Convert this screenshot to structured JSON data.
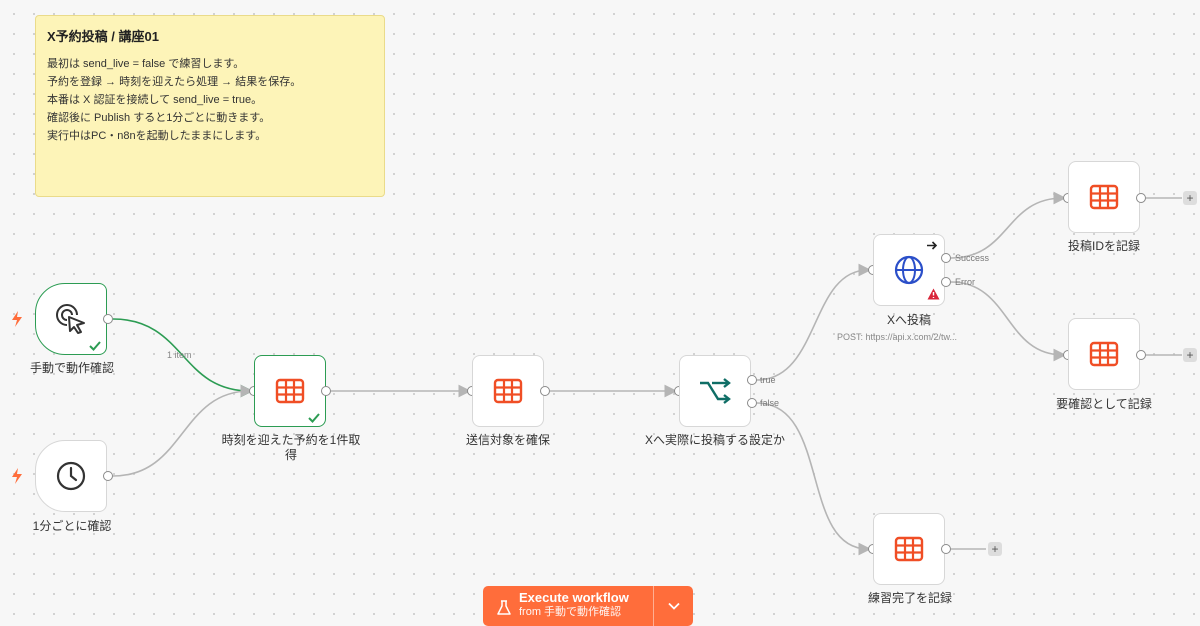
{
  "sticky": {
    "title": "X予約投稿 / 講座01",
    "lines": [
      "最初は send_live = false で練習します。",
      "予約を登録 → 時刻を迎えたら処理 → 結果を保存。",
      "本番は X 認証を接続して send_live = true。",
      "確認後に Publish すると1分ごとに動きます。",
      "実行中はPC・n8nを起動したままにします。"
    ]
  },
  "nodes": {
    "manual": {
      "label": "手動で動作確認"
    },
    "schedule": {
      "label": "1分ごとに確認"
    },
    "fetch": {
      "label_line1": "時刻を迎えた予約を1件取",
      "label_line2": "得"
    },
    "secure": {
      "label": "送信対象を確保"
    },
    "if": {
      "label": "Xへ実際に投稿する設定か",
      "true_label": "true",
      "false_label": "false"
    },
    "post": {
      "label": "Xへ投稿",
      "subtitle": "POST: https://api.x.com/2/tw...",
      "success_label": "Success",
      "error_label": "Error"
    },
    "record_id": {
      "label": "投稿IDを記録"
    },
    "record_check": {
      "label": "要確認として記録"
    },
    "record_practice": {
      "label": "練習完了を記録"
    }
  },
  "edges": {
    "item_count": "1 item"
  },
  "execute": {
    "title": "Execute workflow",
    "subtitle": "from 手動で動作確認"
  },
  "colors": {
    "accent": "#ff6d3b",
    "success": "#2c9c53",
    "table_icon": "#f04e25",
    "globe": "#2b4fc9",
    "switch": "#0f6e66"
  }
}
